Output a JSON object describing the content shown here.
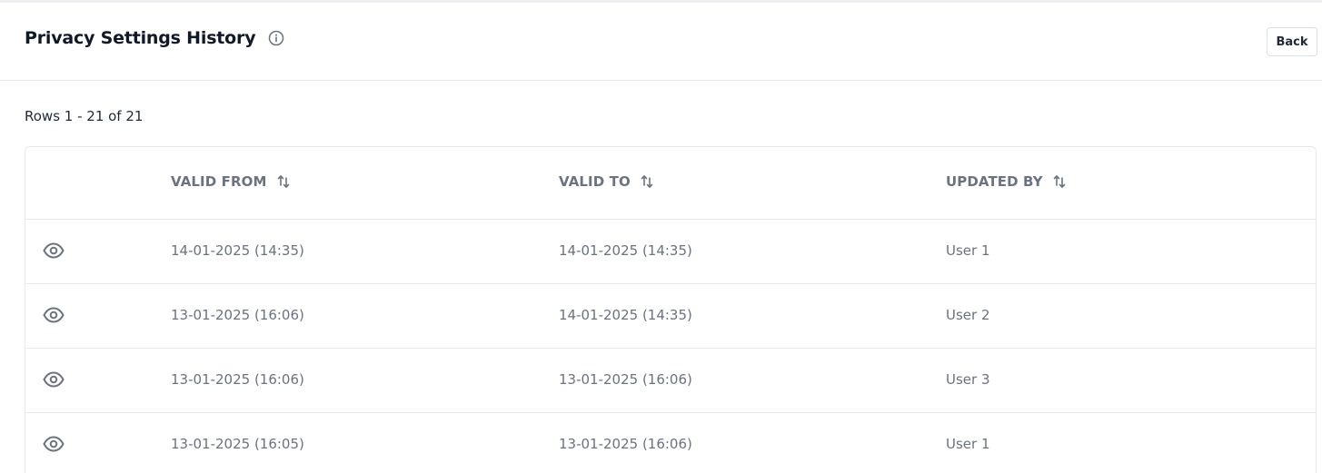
{
  "header": {
    "title": "Privacy Settings History",
    "info_icon": "info-circle-icon",
    "back_label": "Back"
  },
  "table": {
    "rows_summary": "Rows 1 - 21 of 21",
    "columns": [
      "VALID FROM",
      "VALID TO",
      "UPDATED BY"
    ],
    "sort_icon": "sort-arrows-icon",
    "row_icon": "eye-icon",
    "rows": [
      {
        "valid_from": "14-01-2025 (14:35)",
        "valid_to": "14-01-2025 (14:35)",
        "updated_by": "User 1"
      },
      {
        "valid_from": "13-01-2025 (16:06)",
        "valid_to": "14-01-2025 (14:35)",
        "updated_by": "User 2"
      },
      {
        "valid_from": "13-01-2025 (16:06)",
        "valid_to": "13-01-2025 (16:06)",
        "updated_by": "User 3"
      },
      {
        "valid_from": "13-01-2025 (16:05)",
        "valid_to": "13-01-2025 (16:06)",
        "updated_by": "User 1"
      }
    ]
  },
  "colors": {
    "title": "#111827",
    "header_text": "#6b7280",
    "cell_text": "#6b7280",
    "border": "#e8eaee"
  }
}
